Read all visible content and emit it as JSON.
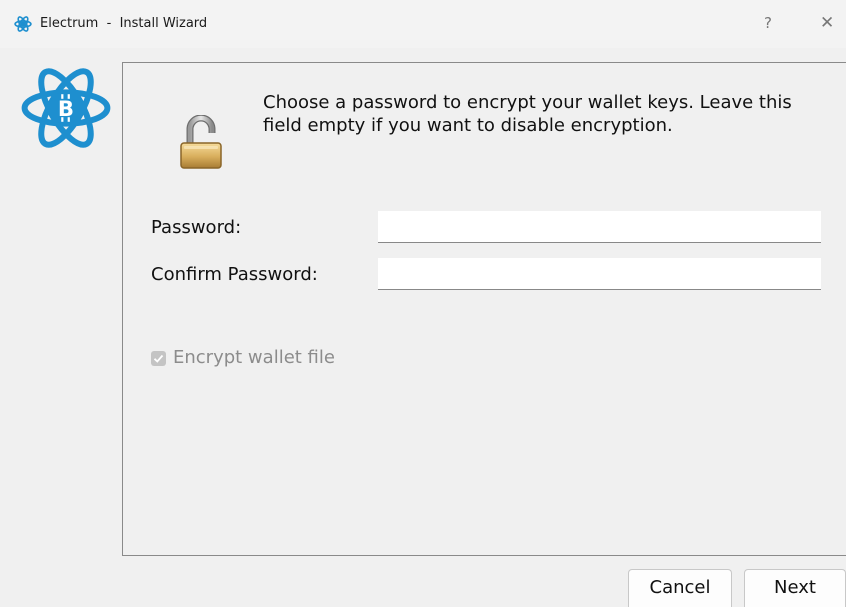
{
  "window": {
    "app_name": "Electrum",
    "separator": "-",
    "title": "Install Wizard",
    "help_label": "?",
    "close_label": "✕"
  },
  "icons": {
    "app": "electrum-logo-icon",
    "logo": "electrum-bitcoin-atom-logo",
    "lock": "unlocked-padlock-icon"
  },
  "main": {
    "info_text": "Choose a password to encrypt your wallet keys. Leave this field empty if you want to disable encryption.",
    "password_label": "Password:",
    "password_value": "",
    "confirm_label": "Confirm Password:",
    "confirm_value": "",
    "encrypt_label": "Encrypt wallet file",
    "encrypt_checked": true,
    "encrypt_enabled": false
  },
  "buttons": {
    "cancel": "Cancel",
    "next": "Next"
  },
  "colors": {
    "brand_blue": "#1e8fcf",
    "lock_gold": "#c9a253",
    "window_bg": "#f0f0f0"
  }
}
